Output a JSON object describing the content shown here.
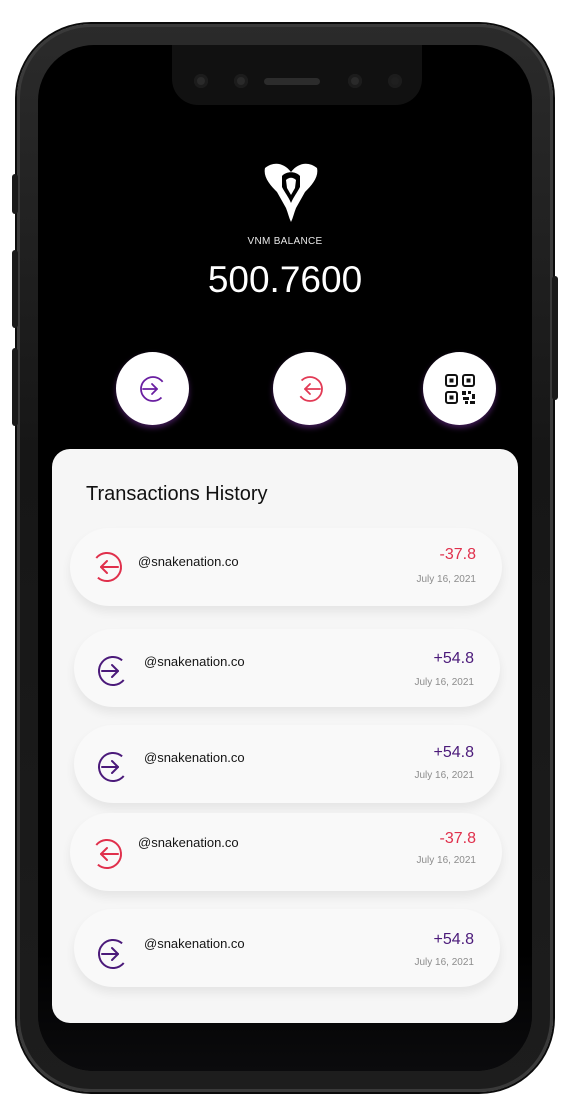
{
  "wallet": {
    "balance_label": "VNM BALANCE",
    "balance_value": "500.7600"
  },
  "actions": [
    {
      "name": "receive-button",
      "icon": "login-arrow-icon",
      "color": "#6a1fa1"
    },
    {
      "name": "send-button",
      "icon": "logout-arrow-icon",
      "color": "#e23a55"
    },
    {
      "name": "qr-code-button",
      "icon": "qr-code-icon",
      "color": "#111111"
    }
  ],
  "history": {
    "title": "Transactions History",
    "items": [
      {
        "direction": "out",
        "icon": "outgoing-arrow-icon",
        "name": "@snakenation.co",
        "amount": "-37.8",
        "date": "July 16, 2021"
      },
      {
        "direction": "in",
        "icon": "incoming-arrow-icon",
        "name": "@snakenation.co",
        "amount": "+54.8",
        "date": "July 16, 2021"
      },
      {
        "direction": "in",
        "icon": "incoming-arrow-icon",
        "name": "@snakenation.co",
        "amount": "+54.8",
        "date": "July 16, 2021"
      },
      {
        "direction": "out",
        "icon": "outgoing-arrow-icon",
        "name": "@snakenation.co",
        "amount": "-37.8",
        "date": "July 16, 2021"
      },
      {
        "direction": "in",
        "icon": "incoming-arrow-icon",
        "name": "@snakenation.co",
        "amount": "+54.8",
        "date": "July 16, 2021"
      }
    ]
  },
  "colors": {
    "incoming": "#4b1a7a",
    "outgoing": "#e0304c",
    "screen_background": "#000000",
    "card_background": "#f6f6f6"
  }
}
